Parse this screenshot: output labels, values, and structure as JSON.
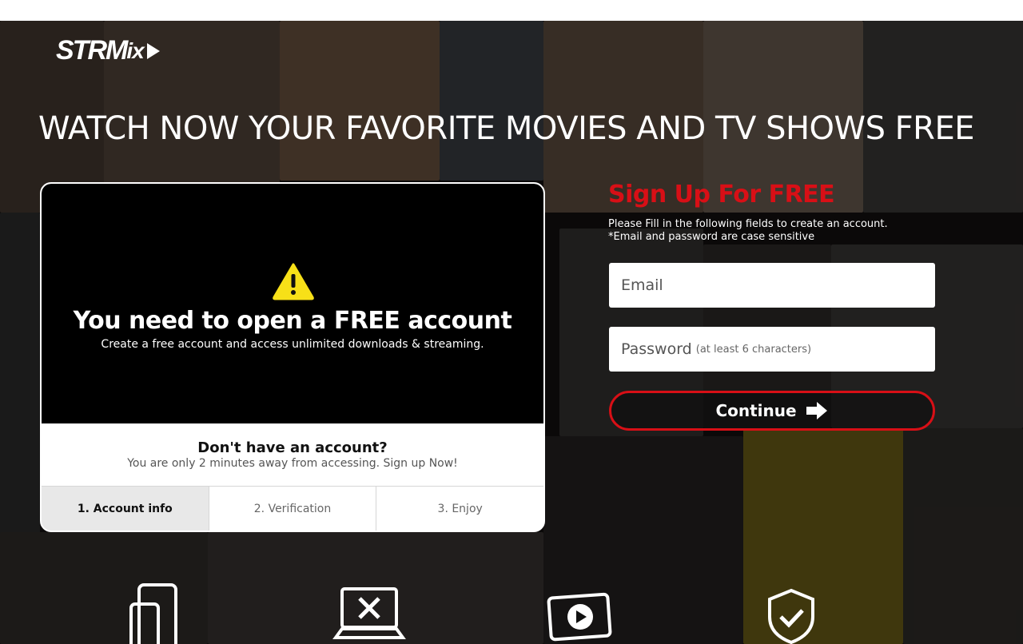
{
  "brand": {
    "logo_main": "STRM",
    "logo_suffix": "ix"
  },
  "headline": "WATCH NOW YOUR FAVORITE MOVIES AND TV SHOWS FREE",
  "notice": {
    "title": "You need to open a FREE account",
    "subtitle": "Create a free account and access unlimited downloads & streaming.",
    "prompt_title": "Don't have an account?",
    "prompt_sub": "You are only 2 minutes away from accessing. Sign up Now!",
    "icon": "warning-icon"
  },
  "steps": [
    {
      "label": "1. Account info",
      "active": true
    },
    {
      "label": "2. Verification",
      "active": false
    },
    {
      "label": "3. Enjoy",
      "active": false
    }
  ],
  "signup": {
    "title": "Sign Up For FREE",
    "note_line1": "Please Fill in the following fields to create an account.",
    "note_line2": "*Email and password are case sensitive",
    "email_placeholder": "Email",
    "password_placeholder": "Password",
    "password_hint": "(at least 6 characters)",
    "continue_label": "Continue"
  },
  "features": [
    "devices-icon",
    "no-ads-icon",
    "play-icon",
    "shield-check-icon"
  ],
  "colors": {
    "accent": "#d80f16",
    "warning": "#f7e018"
  }
}
